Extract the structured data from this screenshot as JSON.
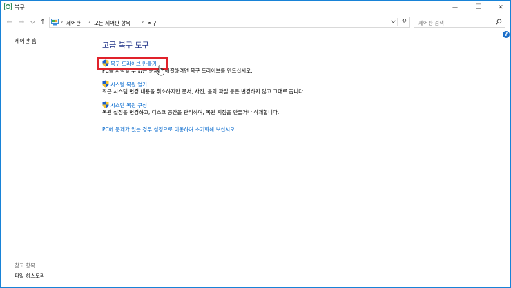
{
  "window": {
    "title": "복구",
    "controls": {
      "minimize": "—",
      "maximize": "☐",
      "close": "✕"
    }
  },
  "nav": {
    "breadcrumb": [
      "제어판",
      "모든 제어판 항목",
      "복구"
    ],
    "search_placeholder": "제어판 검색"
  },
  "sidebar": {
    "home": "제어판 홈",
    "see_also_header": "참고 항목",
    "see_also_items": [
      "파일 히스토리"
    ]
  },
  "main": {
    "heading": "고급 복구 도구",
    "tools": [
      {
        "link": "복구 드라이브 만들기",
        "description": "PC를 시작할 수 없는 문제를 해결하려면 복구 드라이브를 만드십시오."
      },
      {
        "link": "시스템 복원 열기",
        "description": "최근 시스템 변경 내용을 취소하지만 문서, 사진, 음악 파일 등은 변경하지 않고 그대로 둡니다."
      },
      {
        "link": "시스템 복원 구성",
        "description": "복원 설정을 변경하고, 디스크 공간을 관리하며, 복원 지점을 만들거나 삭제합니다."
      }
    ],
    "reset_link": "PC에 문제가 있는 경우 설정으로 이동하여 초기화해 보십시오."
  },
  "colors": {
    "link": "#0066cc",
    "heading": "#1e3287",
    "highlight": "#e0222b",
    "border": "#1883d7"
  }
}
